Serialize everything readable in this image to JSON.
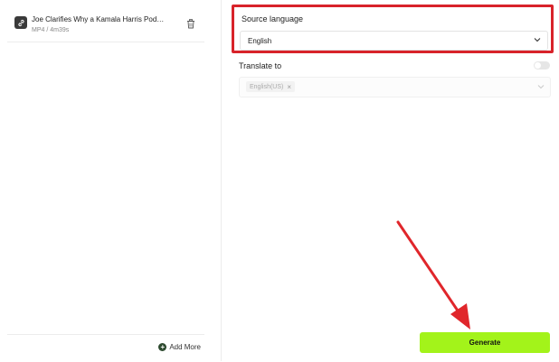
{
  "file": {
    "title": "Joe Clarifies Why a Kamala Harris Pod…",
    "meta": "MP4 / 4m39s"
  },
  "sidebar": {
    "add_more_label": "Add More"
  },
  "source_language": {
    "label": "Source language",
    "value": "English"
  },
  "translate_to": {
    "label": "Translate to",
    "enabled": false,
    "selected": "English(US)"
  },
  "generate_label": "Generate",
  "colors": {
    "accent_green": "#a3f31a",
    "highlight_red": "#d8232a"
  }
}
